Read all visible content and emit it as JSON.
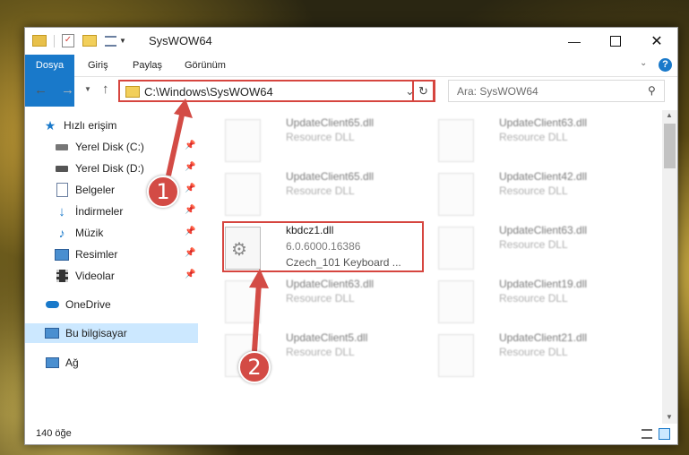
{
  "window": {
    "title": "SysWOW64"
  },
  "ribbon": {
    "tabs": [
      "Dosya",
      "Giriş",
      "Paylaş",
      "Görünüm"
    ]
  },
  "address": {
    "path": "C:\\Windows\\SysWOW64"
  },
  "search": {
    "placeholder": "Ara: SysWOW64"
  },
  "nav": {
    "quick_access": "Hızlı erişim",
    "items": [
      "Yerel Disk (C:)",
      "Yerel Disk (D:)",
      "Belgeler",
      "İndirmeler",
      "Müzik",
      "Resimler",
      "Videolar"
    ],
    "onedrive": "OneDrive",
    "this_pc": "Bu bilgisayar",
    "network": "Ağ"
  },
  "files": {
    "left": [
      {
        "name": "UpdateClient65.dll",
        "sub": "Resource DLL"
      },
      {
        "name": "UpdateClient65.dll",
        "sub": "Resource DLL"
      },
      {
        "name": "kbdcz1.dll",
        "sub": "6.0.6000.16386",
        "sub2": "Czech_101 Keyboard ..."
      },
      {
        "name": "UpdateClient63.dll",
        "sub": "Resource DLL"
      },
      {
        "name": "UpdateClient5.dll",
        "sub": "Resource DLL"
      }
    ],
    "right": [
      {
        "name": "UpdateClient63.dll",
        "sub": "Resource DLL"
      },
      {
        "name": "UpdateClient42.dll",
        "sub": "Resource DLL"
      },
      {
        "name": "UpdateClient63.dll",
        "sub": "Resource DLL"
      },
      {
        "name": "UpdateClient19.dll",
        "sub": "Resource DLL"
      },
      {
        "name": "UpdateClient21.dll",
        "sub": "Resource DLL"
      }
    ]
  },
  "status": {
    "count": "140 öğe"
  },
  "callouts": {
    "one": "1",
    "two": "2"
  },
  "colors": {
    "accent": "#1979ca",
    "highlight": "#d6453f",
    "selection": "#cce8ff"
  }
}
